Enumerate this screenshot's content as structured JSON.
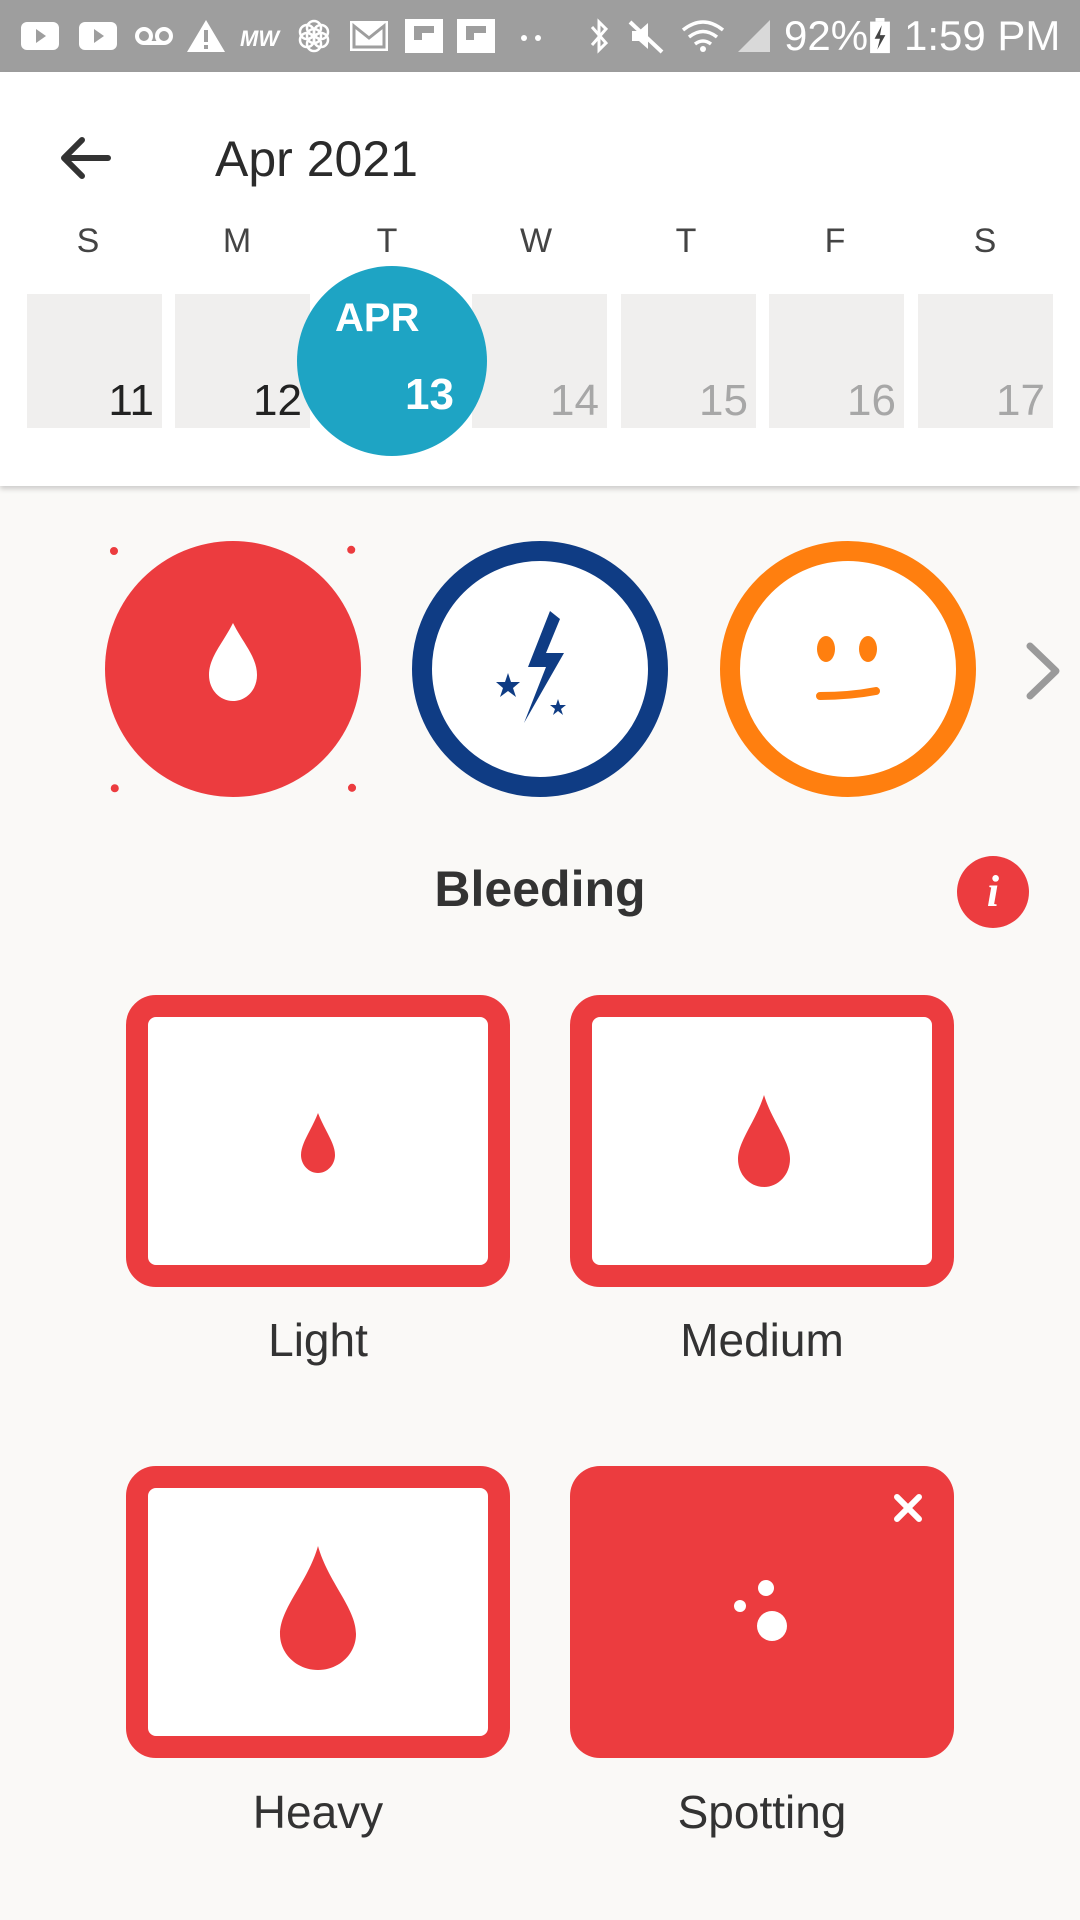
{
  "status_bar": {
    "battery": "92%",
    "time": "1:59 PM"
  },
  "header": {
    "month_title": "Apr 2021",
    "weekdays": [
      "S",
      "M",
      "T",
      "W",
      "T",
      "F",
      "S"
    ],
    "days": [
      "11",
      "12",
      "13",
      "14",
      "15",
      "16",
      "17"
    ],
    "selected_month": "APR",
    "selected_day": "13"
  },
  "categories": [
    {
      "name": "bleeding",
      "icon": "blood-drop-icon",
      "color": "#ec3c3f",
      "selected": true
    },
    {
      "name": "pain",
      "icon": "lightning-bolt-icon",
      "color": "#0f3c84",
      "selected": false
    },
    {
      "name": "emotion",
      "icon": "neutral-face-icon",
      "color": "#ff7f0f",
      "selected": false
    }
  ],
  "section": {
    "title": "Bleeding"
  },
  "options": [
    {
      "label": "Light",
      "icon": "small-drop-icon",
      "selected": false
    },
    {
      "label": "Medium",
      "icon": "medium-drop-icon",
      "selected": false
    },
    {
      "label": "Heavy",
      "icon": "large-drop-icon",
      "selected": false
    },
    {
      "label": "Spotting",
      "icon": "spotting-dots-icon",
      "selected": true
    }
  ],
  "colors": {
    "accent_red": "#ec3c3f",
    "today_blue": "#1ea4c4",
    "pain_navy": "#0f3c84",
    "emotion_orange": "#ff7f0f"
  }
}
